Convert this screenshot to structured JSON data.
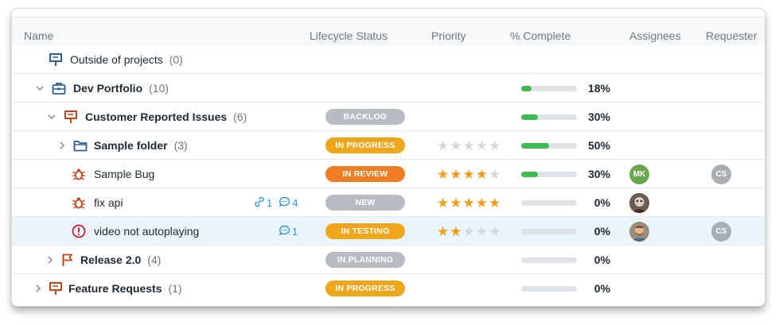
{
  "columns": {
    "name": "Name",
    "lifecycle": "Lifecycle Status",
    "priority": "Priority",
    "complete": "% Complete",
    "assignees": "Assignees",
    "requester": "Requester"
  },
  "colors": {
    "backlog": "#b7bcc2",
    "in_progress": "#f0a61a",
    "in_review": "#f07d24",
    "new": "#b7bcc2",
    "in_testing": "#f0a61a",
    "in_planning": "#b7bcc2",
    "star_on": "#f59d1b",
    "star_off": "#d4d7db",
    "progress_fill": "#3dbb52",
    "link_blue": "#2b9ad3",
    "portfolio_icon": "#2d5f93",
    "project_icon": "#c2461d"
  },
  "rows": [
    {
      "name": "Outside of projects",
      "count": "(0)",
      "bold": false,
      "icon": "presentation-board-icon",
      "status": "",
      "stars": null,
      "progress": null,
      "pct": ""
    },
    {
      "name": "Dev Portfolio",
      "count": "(10)",
      "bold": true,
      "icon": "briefcase-icon",
      "status": "",
      "stars": null,
      "progress": 0.18,
      "pct": "18%"
    },
    {
      "name": "Customer Reported Issues",
      "count": "(6)",
      "bold": true,
      "icon": "project-board-icon",
      "status": "BACKLOG",
      "stars": null,
      "progress": 0.3,
      "pct": "30%"
    },
    {
      "name": "Sample folder",
      "count": "(3)",
      "bold": true,
      "icon": "folder-icon",
      "status": "IN PROGRESS",
      "stars": 0,
      "progress": 0.5,
      "pct": "50%"
    },
    {
      "name": "Sample Bug",
      "count": "",
      "bold": false,
      "icon": "bug-icon",
      "status": "IN REVIEW",
      "stars": 4,
      "progress": 0.3,
      "pct": "30%",
      "assignee": "MK",
      "requester": "CS"
    },
    {
      "name": "fix api",
      "count": "",
      "bold": false,
      "icon": "bug-icon",
      "status": "NEW",
      "stars": 5,
      "progress": 0.0,
      "pct": "0%",
      "links": "1",
      "comments": "4"
    },
    {
      "name": "video not autoplaying",
      "count": "",
      "bold": false,
      "icon": "alert-circle-icon",
      "status": "IN TESTING",
      "stars": 2,
      "progress": 0.0,
      "pct": "0%",
      "comments": "1",
      "requester": "CS"
    },
    {
      "name": "Release 2.0",
      "count": "(4)",
      "bold": true,
      "icon": "flag-icon",
      "status": "IN PLANNING",
      "stars": null,
      "progress": 0.0,
      "pct": "0%"
    },
    {
      "name": "Feature Requests",
      "count": "(1)",
      "bold": true,
      "icon": "project-board-icon",
      "status": "IN PROGRESS",
      "stars": null,
      "progress": 0.0,
      "pct": "0%"
    }
  ]
}
